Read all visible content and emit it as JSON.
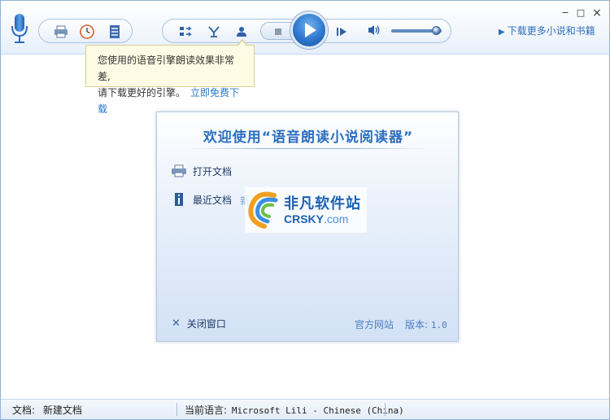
{
  "window": {
    "controls": {
      "minimize": "−",
      "maximize": "□",
      "close": "×"
    }
  },
  "toolbar": {
    "more_link": "下载更多小说和书籍",
    "icons": [
      "microphone-icon",
      "print-icon",
      "clock-icon",
      "list-icon",
      "switch-icon",
      "exchange-icon",
      "user-icon",
      "stop-icon",
      "play-icon",
      "next-icon",
      "volume-icon"
    ],
    "volume_level": 0.9
  },
  "tooltip": {
    "line1": "您使用的语音引擎朗读效果非常差,",
    "line2": "请下载更好的引擎。",
    "link": "立即免费下载"
  },
  "dialog": {
    "title": "欢迎使用“语音朗读小说阅读器”",
    "open_doc": "打开文档",
    "recent_doc": "最近文档",
    "recent_extra": "新",
    "close": "关闭窗口",
    "site": "官方网站",
    "version_label": "版本:",
    "version_value": "1.0"
  },
  "watermark": {
    "line1": "非凡软件站",
    "line2_main": "CRSKY",
    "line2_suffix": ".com"
  },
  "status": {
    "doc_label": "文档:",
    "doc_value": "新建文档",
    "lang_label": "当前语言:",
    "lang_value": "Microsoft Lili - Chinese (China)"
  },
  "colors": {
    "accent": "#2b6fc0",
    "link": "#2a78c8",
    "tooltip_bg": "#fdfbe3"
  }
}
